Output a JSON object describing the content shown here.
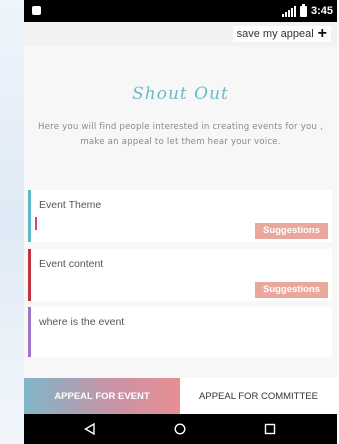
{
  "status_bar": {
    "time": "3:45"
  },
  "top_bar": {
    "save_label": "save my appeal"
  },
  "hero": {
    "logo_text": "Shout Out",
    "description": "Here you will find people interested in creating events for you , make an appeal to let them hear your voice."
  },
  "fields": [
    {
      "label": "Event Theme",
      "accent": "#5fb8c8",
      "suggestions_label": "Suggestions"
    },
    {
      "label": "Event content",
      "accent": "#c4343f",
      "suggestions_label": "Suggestions"
    },
    {
      "label": "where is the event",
      "accent": "#a078c8"
    }
  ],
  "tabs": [
    {
      "label": "APPEAL FOR EVENT",
      "active": true
    },
    {
      "label": "APPEAL FOR COMMITTEE",
      "active": false
    }
  ],
  "colors": {
    "suggestion_bg": "#e9a89b",
    "logo": "#6bbcc5"
  },
  "icons": {
    "back": "back-triangle-icon",
    "home": "home-circle-icon",
    "recents": "recents-square-icon"
  }
}
